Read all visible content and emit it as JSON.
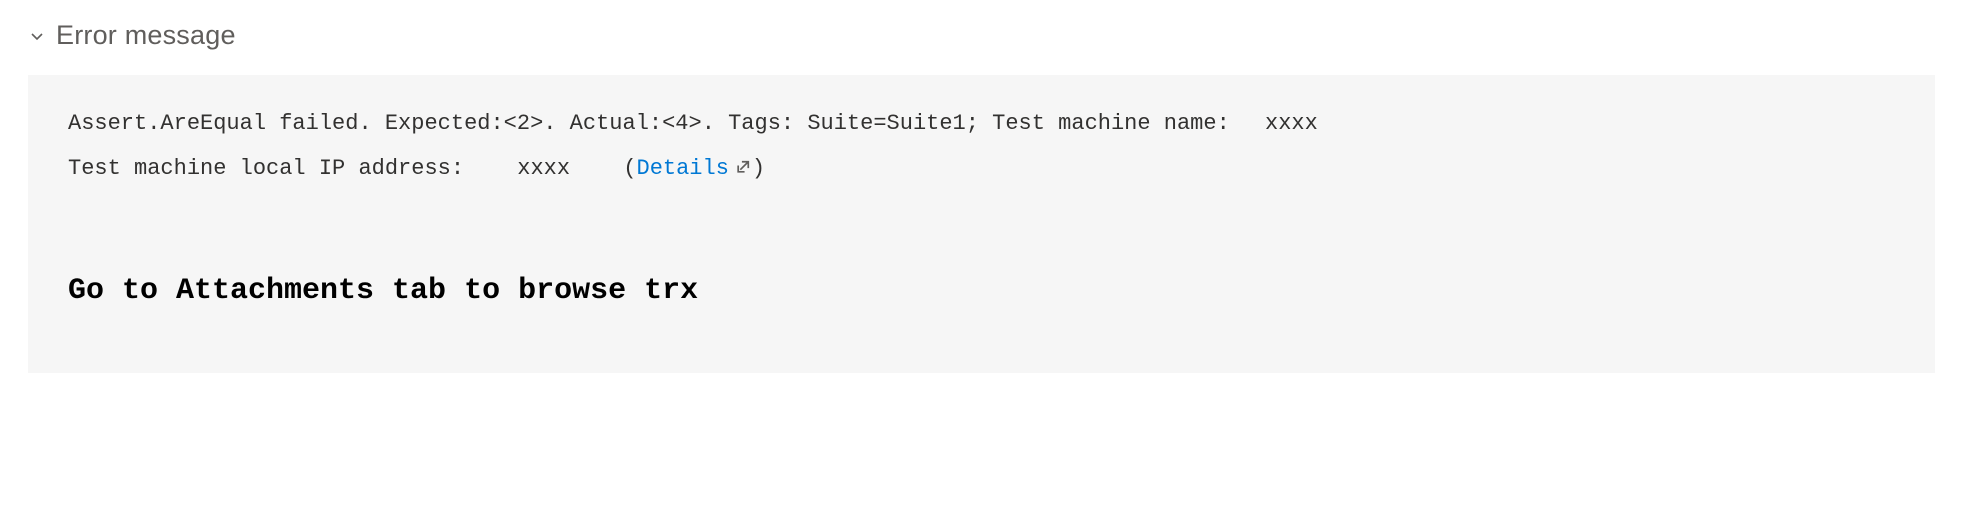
{
  "section": {
    "title": "Error message"
  },
  "error": {
    "assert_text": "Assert.AreEqual failed. Expected:<2>. Actual:<4>. Tags: Suite=Suite1; Test machine name: ",
    "machine_name": "xxxx",
    "ip_label": "Test machine local IP address:",
    "ip_value": "xxxx",
    "paren_open": "(",
    "details_link": "Details",
    "paren_close": ")"
  },
  "instruction": {
    "text": "Go to Attachments tab to browse trx"
  }
}
